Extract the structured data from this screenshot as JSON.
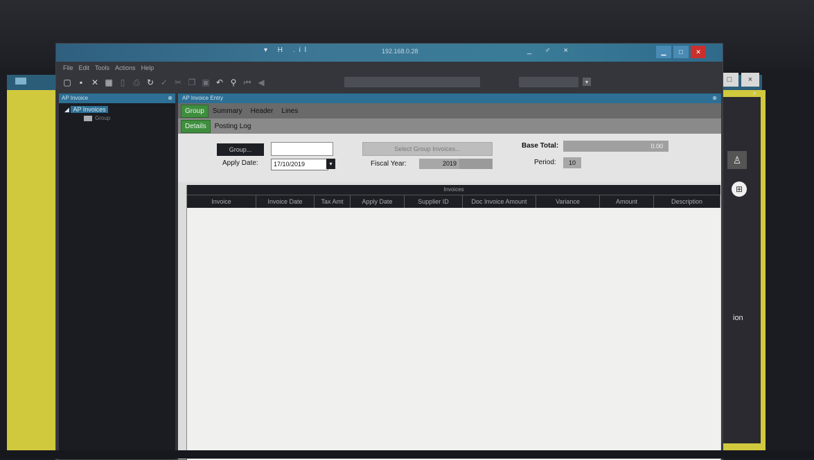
{
  "window": {
    "title_ip": "192.168.0.28",
    "title_controls": "▾ H .il",
    "title_right_controls": "_ ♂ ×"
  },
  "menu": [
    "File",
    "Edit",
    "Tools",
    "Actions",
    "Help"
  ],
  "toolbar": {
    "icons": [
      "new-icon",
      "save-icon",
      "delete-icon",
      "grid-icon",
      "doc-icon",
      "print-icon",
      "refresh-icon",
      "check-icon",
      "cut-icon",
      "copy-icon",
      "paste-icon",
      "undo-icon",
      "find-icon",
      "first-icon",
      "prev-icon"
    ]
  },
  "tree": {
    "header": "AP Invoice",
    "root": "AP Invoices",
    "child": "Group"
  },
  "entry": {
    "header": "AP Invoice Entry",
    "tabs_row1": [
      "Group",
      "Summary",
      "Header",
      "Lines"
    ],
    "tabs_row2": [
      "Details",
      "Posting Log"
    ],
    "form": {
      "group_button": "Group...",
      "group_value": "",
      "apply_date_label": "Apply Date:",
      "apply_date_value": "17/10/2019",
      "select_group_button": "Select Group Invoices...",
      "fiscal_year_label": "Fiscal Year:",
      "fiscal_year_value": "2019",
      "base_total_label": "Base Total:",
      "base_total_value": "0.00",
      "period_label": "Period:",
      "period_value": "10"
    },
    "grid": {
      "caption": "Invoices",
      "columns": [
        "Invoice",
        "Invoice Date",
        "Tax Amt",
        "Apply Date",
        "Supplier ID",
        "Doc Invoice Amount",
        "Variance",
        "Amount",
        "Description"
      ]
    }
  },
  "desktop": {
    "partial_text": "ion",
    "close_label": "×",
    "restore_label": "□"
  },
  "colors": {
    "accent": "#2d6f95",
    "active_tab": "#3e8e3e",
    "background_yellow": "#d1c93d"
  }
}
